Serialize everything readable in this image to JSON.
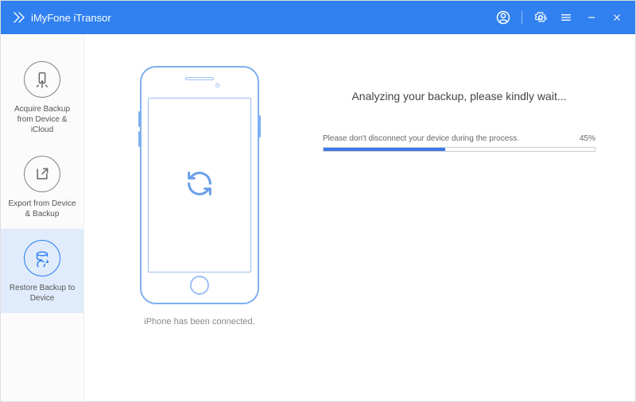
{
  "header": {
    "app_title": "iMyFone iTransor"
  },
  "sidebar": {
    "items": [
      {
        "label": "Acquire Backup from Device & iCloud"
      },
      {
        "label": "Export from Device & Backup"
      },
      {
        "label": "Restore Backup to Device"
      }
    ],
    "active_index": 2
  },
  "phone": {
    "status": "iPhone has been connected."
  },
  "progress": {
    "title": "Analyzing your backup, please kindly wait...",
    "note": "Please don't disconnect your device during the process.",
    "percent_label": "45%",
    "percent_value": 45
  },
  "colors": {
    "accent": "#3080f0"
  }
}
